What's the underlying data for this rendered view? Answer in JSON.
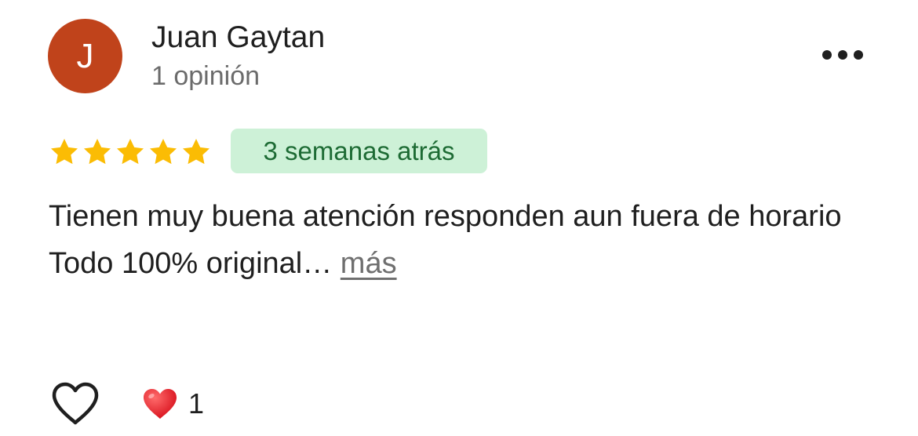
{
  "author": {
    "initial": "J",
    "name": "Juan Gaytan",
    "review_count": "1 opinión",
    "avatar_color": "#c0431b"
  },
  "menu": {
    "icon": "more-horizontal-icon"
  },
  "rating": {
    "stars": 5,
    "max": 5,
    "star_color": "#fbbc04"
  },
  "date_badge": {
    "text": "3 semanas atrás",
    "bg_color": "#cdf1d7",
    "text_color": "#1d6b34"
  },
  "review": {
    "line1": "Tienen muy buena atención responden aun fuera de horario",
    "line2": "Todo 100% original…",
    "more_label": "más"
  },
  "reactions": {
    "like_icon": "heart-outline-icon",
    "reaction_icon": "red-heart-icon",
    "count": "1"
  }
}
